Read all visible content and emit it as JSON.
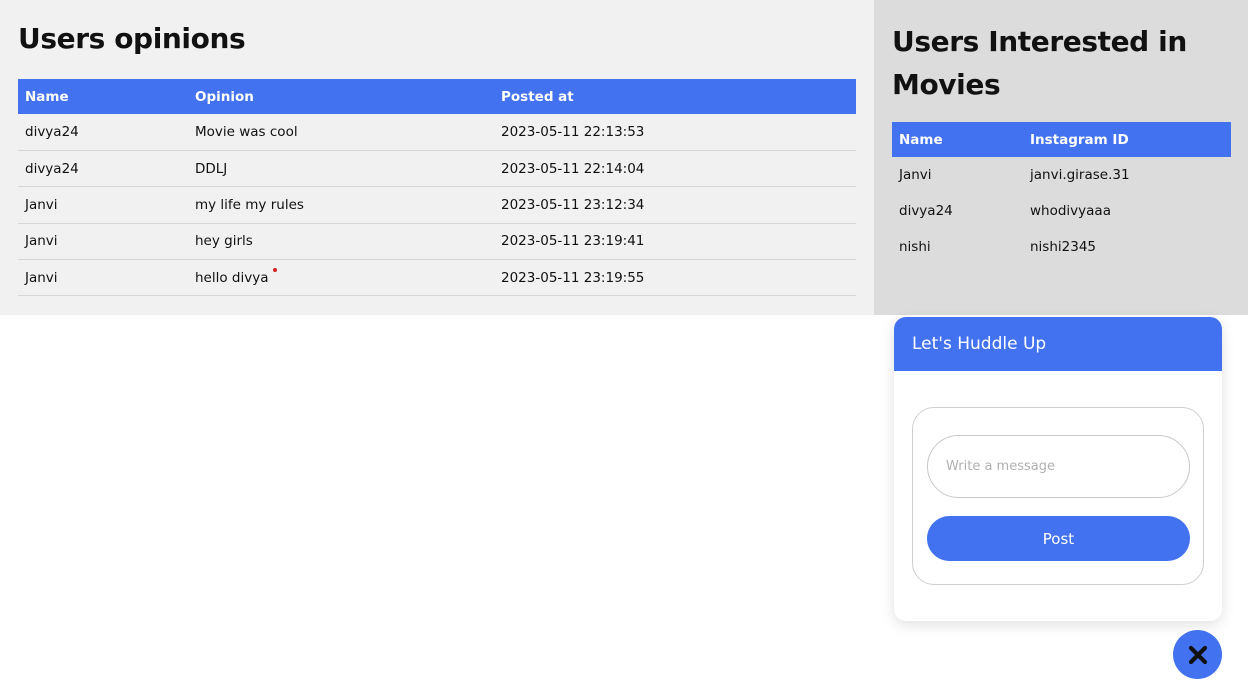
{
  "opinions": {
    "title": "Users opinions",
    "columns": [
      "Name",
      "Opinion",
      "Posted at"
    ],
    "rows": [
      {
        "name": "divya24",
        "opinion": "Movie was cool",
        "posted_at": "2023-05-11 22:13:53"
      },
      {
        "name": "divya24",
        "opinion": "DDLJ",
        "posted_at": "2023-05-11 22:14:04"
      },
      {
        "name": "Janvi",
        "opinion": "my life my rules",
        "posted_at": "2023-05-11 23:12:34"
      },
      {
        "name": "Janvi",
        "opinion": "hey girls",
        "posted_at": "2023-05-11 23:19:41"
      },
      {
        "name": "Janvi",
        "opinion": "hello divya",
        "posted_at": "2023-05-11 23:19:55"
      }
    ]
  },
  "interested": {
    "title": "Users Interested in Movies",
    "columns": [
      "Name",
      "Instagram ID"
    ],
    "rows": [
      {
        "name": "Janvi",
        "instagram": "janvi.girase.31"
      },
      {
        "name": "divya24",
        "instagram": "whodivyaaa"
      },
      {
        "name": "nishi",
        "instagram": "nishi2345"
      }
    ]
  },
  "chat": {
    "header": "Let's Huddle Up",
    "input_placeholder": "Write a message",
    "input_value": "",
    "post_label": "Post",
    "close_icon": "close-icon"
  },
  "colors": {
    "accent": "#4272f0",
    "left_bg": "#f1f1f1",
    "right_bg": "#dcdcdc"
  }
}
